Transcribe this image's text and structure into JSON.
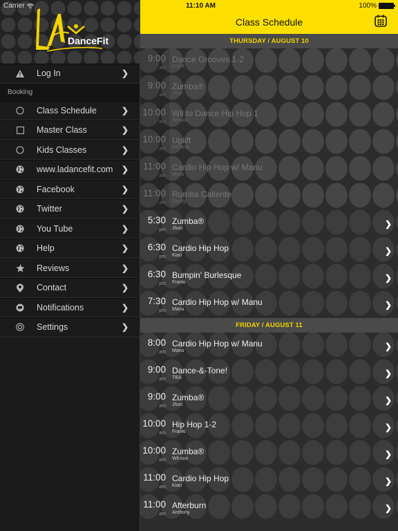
{
  "status_bar": {
    "carrier": "Carrier",
    "time": "11:10 AM",
    "battery": "100%"
  },
  "brand": {
    "logo_text_1": "LA",
    "logo_text_2": "DanceFit",
    "accent_color": "#fcdf00"
  },
  "sidebar": {
    "login": {
      "label": "Log In",
      "icon": "warning-icon"
    },
    "section_label": "Booking",
    "items": [
      {
        "label": "Class Schedule",
        "icon": "circle-icon"
      },
      {
        "label": "Master Class",
        "icon": "square-icon"
      },
      {
        "label": "Kids Classes",
        "icon": "circle-icon"
      },
      {
        "label": "www.ladancefit.com",
        "icon": "globe-icon"
      },
      {
        "label": "Facebook",
        "icon": "globe-icon"
      },
      {
        "label": "Twitter",
        "icon": "globe-icon"
      },
      {
        "label": "You Tube",
        "icon": "globe-icon"
      },
      {
        "label": "Help",
        "icon": "globe-icon"
      },
      {
        "label": "Reviews",
        "icon": "star-icon"
      },
      {
        "label": "Contact",
        "icon": "location-pin-icon"
      },
      {
        "label": "Notifications",
        "icon": "chat-bubble-icon"
      },
      {
        "label": "Settings",
        "icon": "gear-icon"
      }
    ]
  },
  "header": {
    "title": "Class Schedule",
    "calendar_icon": "calendar-icon"
  },
  "days": [
    {
      "label": "THURSDAY / AUGUST 10",
      "classes": [
        {
          "time": "9:00",
          "ampm": "am",
          "title": "Dance Grooves 1-2",
          "instructor": "O'dell",
          "past": true
        },
        {
          "time": "9:00",
          "ampm": "am",
          "title": "Zumba®",
          "instructor": "Jhon",
          "past": true
        },
        {
          "time": "10:00",
          "ampm": "am",
          "title": "Wil to Dance Hip Hop 1",
          "instructor": "Wil-son",
          "past": true
        },
        {
          "time": "10:00",
          "ampm": "am",
          "title": "Uplift",
          "instructor": "Michelle",
          "past": true
        },
        {
          "time": "11:00",
          "ampm": "am",
          "title": "Cardio Hip Hop w/ Manu",
          "instructor": "Manu",
          "past": true
        },
        {
          "time": "11:00",
          "ampm": "am",
          "title": "Rumba Caliente",
          "instructor": "Sandy",
          "past": true
        },
        {
          "time": "5:30",
          "ampm": "pm",
          "title": "Zumba®",
          "instructor": "Jhon",
          "past": false
        },
        {
          "time": "6:30",
          "ampm": "pm",
          "title": "Cardio Hip Hop",
          "instructor": "Kiari",
          "past": false
        },
        {
          "time": "6:30",
          "ampm": "pm",
          "title": "Bumpin' Burlesque",
          "instructor": "Franki",
          "past": false
        },
        {
          "time": "7:30",
          "ampm": "pm",
          "title": "Cardio Hip Hop w/ Manu",
          "instructor": "Manu",
          "past": false
        }
      ]
    },
    {
      "label": "FRIDAY / AUGUST 11",
      "classes": [
        {
          "time": "8:00",
          "ampm": "am",
          "title": "Cardio Hip Hop w/ Manu",
          "instructor": "Manu",
          "past": false
        },
        {
          "time": "9:00",
          "ampm": "am",
          "title": "Dance-&-Tone!",
          "instructor": "TBA",
          "past": false
        },
        {
          "time": "9:00",
          "ampm": "am",
          "title": "Zumba®",
          "instructor": "Jhon",
          "past": false
        },
        {
          "time": "10:00",
          "ampm": "am",
          "title": "Hip Hop 1-2",
          "instructor": "Franki",
          "past": false
        },
        {
          "time": "10:00",
          "ampm": "am",
          "title": "Zumba®",
          "instructor": "Wil-son",
          "past": false
        },
        {
          "time": "11:00",
          "ampm": "am",
          "title": "Cardio Hip Hop",
          "instructor": "Kiari",
          "past": false
        },
        {
          "time": "11:00",
          "ampm": "am",
          "title": "Afterburn",
          "instructor": "Anthony",
          "past": false
        }
      ]
    }
  ]
}
